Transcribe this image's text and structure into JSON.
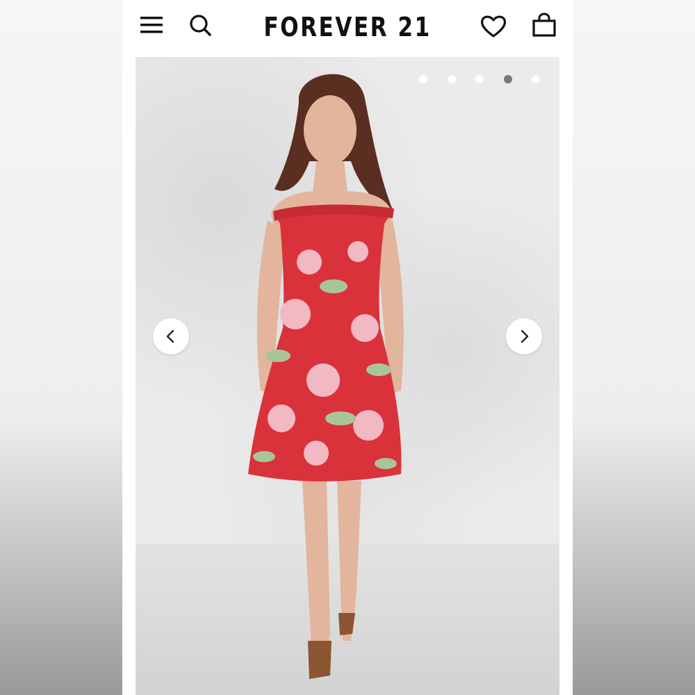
{
  "header": {
    "brand": "FOREVER 21",
    "icons": [
      "menu-icon",
      "search-icon",
      "heart-icon",
      "bag-icon"
    ]
  },
  "gallery": {
    "slide_count": 5,
    "active_slide": 4,
    "image_subject": "model-in-floral-off-shoulder-dress"
  },
  "colors": {
    "brand_text": "#111111",
    "dress_red": "#d9323a",
    "dot_active": "#777777",
    "dot_inactive": "#ffffff"
  }
}
